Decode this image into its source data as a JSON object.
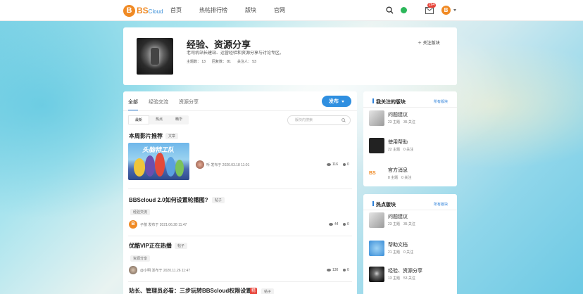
{
  "nav": {
    "logo_letter": "B",
    "logo_text": "BS",
    "logo_sub": "Cloud",
    "links": [
      "首页",
      "热帖排行榜",
      "版块",
      "官网"
    ],
    "mail_badge": "264",
    "avatar_letter": "B"
  },
  "forum": {
    "title": "经验、资源分享",
    "description": "老司机站长建站、运营经验和资源分享与讨论专区。",
    "stats": [
      "主题数： 13",
      "回复数： 81",
      "关注人： 53"
    ],
    "follow_label": "关注版块"
  },
  "main": {
    "tabs": [
      "全部",
      "经验交流",
      "资源分享"
    ],
    "publish_label": "发布",
    "subtabs": [
      "最新",
      "热点",
      "精华"
    ],
    "search_placeholder": "版块内搜索",
    "posts": [
      {
        "title": "本周影片推荐",
        "type": "文章",
        "author": "听",
        "meta": "发布于 2020.03.18 11:01",
        "views": "116",
        "comments": "0",
        "image_text": "头脑特工队"
      },
      {
        "title": "BBScloud 2.0如何设置轮播图?",
        "type": "帖子",
        "tag": "经验交流",
        "author_letter": "B",
        "meta": "子敬 发布于 2021.06.28 11:47",
        "views": "44",
        "comments": "0"
      },
      {
        "title": "优酷VIP正在热播",
        "type": "帖子",
        "tag": "资源分享",
        "meta": "@小明 发布于 2020.11.26 11:47",
        "views": "130",
        "comments": "0"
      },
      {
        "title": "站长、管理员必看：三步玩转BBScloud权限设置",
        "badge": "精",
        "type": "帖子"
      }
    ]
  },
  "side1": {
    "title": "我关注的版块",
    "all_label": "所有版块",
    "items": [
      {
        "name": "问题建议",
        "count": "23 主题　35 关注"
      },
      {
        "name": "使用帮助",
        "count": "22 主题　0 关注"
      },
      {
        "name": "官方消息",
        "count": "8 主题　0 关注",
        "thumb_text": "BS"
      }
    ]
  },
  "side2": {
    "title": "热点版块",
    "all_label": "所有版块",
    "items": [
      {
        "name": "问题建议",
        "count": "23 主题　35 关注"
      },
      {
        "name": "帮助文档",
        "count": "21 主题　0 关注"
      },
      {
        "name": "经验、资源分享",
        "count": "13 主题　53 关注"
      }
    ]
  }
}
